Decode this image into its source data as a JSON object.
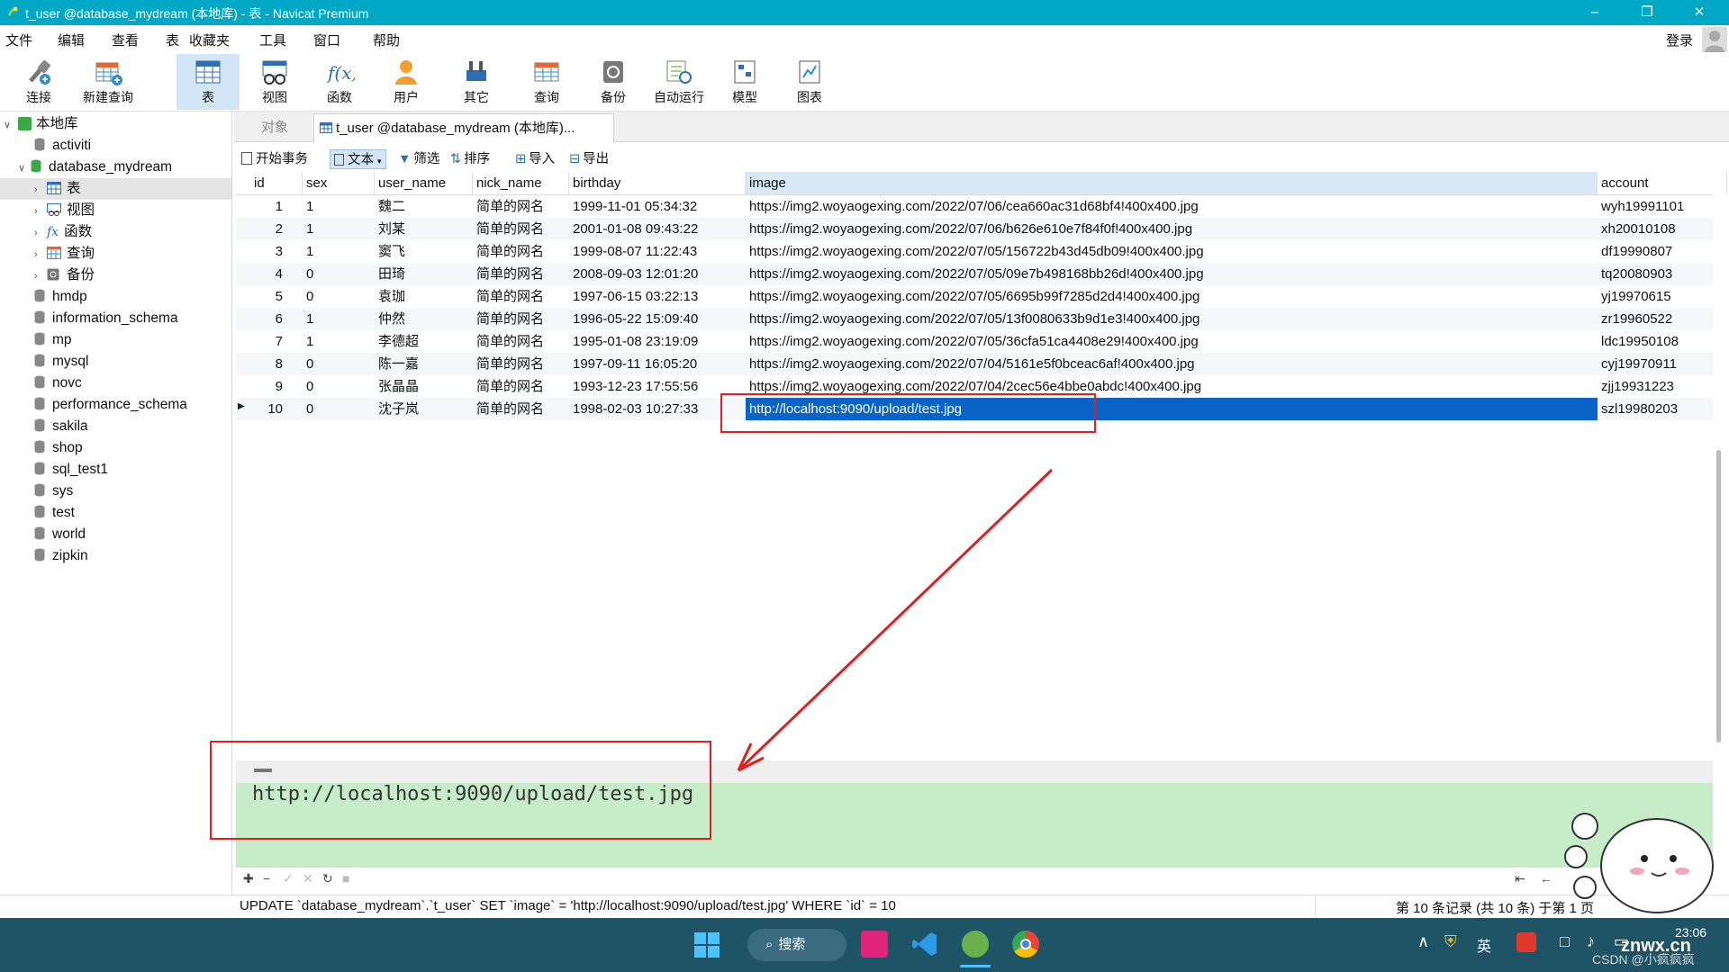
{
  "window": {
    "title": "t_user @database_mydream (本地库) - 表 - Navicat Premium",
    "login": "登录"
  },
  "menu": [
    "文件",
    "编辑",
    "查看",
    "表",
    "收藏夹",
    "工具",
    "窗口",
    "帮助"
  ],
  "toolbar": [
    "连接",
    "新建查询",
    "表",
    "视图",
    "函数",
    "用户",
    "其它",
    "查询",
    "备份",
    "自动运行",
    "模型",
    "图表"
  ],
  "sidebar": {
    "root": "本地库",
    "items": [
      "activiti",
      "database_mydream",
      "表",
      "视图",
      "函数",
      "查询",
      "备份",
      "hmdp",
      "information_schema",
      "mp",
      "mysql",
      "novc",
      "performance_schema",
      "sakila",
      "shop",
      "sql_test1",
      "sys",
      "test",
      "world",
      "zipkin"
    ]
  },
  "tabs": {
    "objects": "对象",
    "active": "t_user @database_mydream (本地库)..."
  },
  "data_toolbar": {
    "begin_tx": "开始事务",
    "text": "文本",
    "filter": "筛选",
    "sort": "排序",
    "import": "导入",
    "export": "导出"
  },
  "grid": {
    "columns": [
      "id",
      "sex",
      "user_name",
      "nick_name",
      "birthday",
      "image",
      "account"
    ],
    "rows": [
      [
        "1",
        "1",
        "魏二",
        "简单的网名",
        "1999-11-01 05:34:32",
        "https://img2.woyaogexing.com/2022/07/06/cea660ac31d68bf4!400x400.jpg",
        "wyh19991101"
      ],
      [
        "2",
        "1",
        "刘某",
        "简单的网名",
        "2001-01-08 09:43:22",
        "https://img2.woyaogexing.com/2022/07/06/b626e610e7f84f0f!400x400.jpg",
        "xh20010108"
      ],
      [
        "3",
        "1",
        "窦飞",
        "简单的网名",
        "1999-08-07 11:22:43",
        "https://img2.woyaogexing.com/2022/07/05/156722b43d45db09!400x400.jpg",
        "df19990807"
      ],
      [
        "4",
        "0",
        "田琦",
        "简单的网名",
        "2008-09-03 12:01:20",
        "https://img2.woyaogexing.com/2022/07/05/09e7b498168bb26d!400x400.jpg",
        "tq20080903"
      ],
      [
        "5",
        "0",
        "袁珈",
        "简单的网名",
        "1997-06-15 03:22:13",
        "https://img2.woyaogexing.com/2022/07/05/6695b99f7285d2d4!400x400.jpg",
        "yj19970615"
      ],
      [
        "6",
        "1",
        "仲然",
        "简单的网名",
        "1996-05-22 15:09:40",
        "https://img2.woyaogexing.com/2022/07/05/13f0080633b9d1e3!400x400.jpg",
        "zr19960522"
      ],
      [
        "7",
        "1",
        "李德超",
        "简单的网名",
        "1995-01-08 23:19:09",
        "https://img2.woyaogexing.com/2022/07/05/36cfa51ca4408e29!400x400.jpg",
        "ldc19950108"
      ],
      [
        "8",
        "0",
        "陈一嘉",
        "简单的网名",
        "1997-09-11 16:05:20",
        "https://img2.woyaogexing.com/2022/07/04/5161e5f0bceac6af!400x400.jpg",
        "cyj19970911"
      ],
      [
        "9",
        "0",
        "张晶晶",
        "简单的网名",
        "1993-12-23 17:55:56",
        "https://img2.woyaogexing.com/2022/07/04/2cec56e4bbe0abdc!400x400.jpg",
        "zjj19931223"
      ],
      [
        "10",
        "0",
        "沈子岚",
        "简单的网名",
        "1998-02-03 10:27:33",
        "http://localhost:9090/upload/test.jpg",
        "szl19980203"
      ]
    ]
  },
  "editor": {
    "value": "http://localhost:9090/upload/test.jpg"
  },
  "status": {
    "sql": "UPDATE `database_mydream`.`t_user` SET `image` = 'http://localhost:9090/upload/test.jpg' WHERE `id` = 10",
    "records": "第 10 条记录 (共 10 条) 于第 1 页"
  },
  "taskbar": {
    "search": "搜索",
    "ime": "英",
    "time": "23:06",
    "watermark": "CSDN @小疯疯疯",
    "watermark2": "znwx.cn"
  },
  "colors": {
    "titlebar": "#00a8c6",
    "selection": "#0a64c8",
    "editor_bg": "#c7ecc8",
    "annotation": "#e02020"
  }
}
